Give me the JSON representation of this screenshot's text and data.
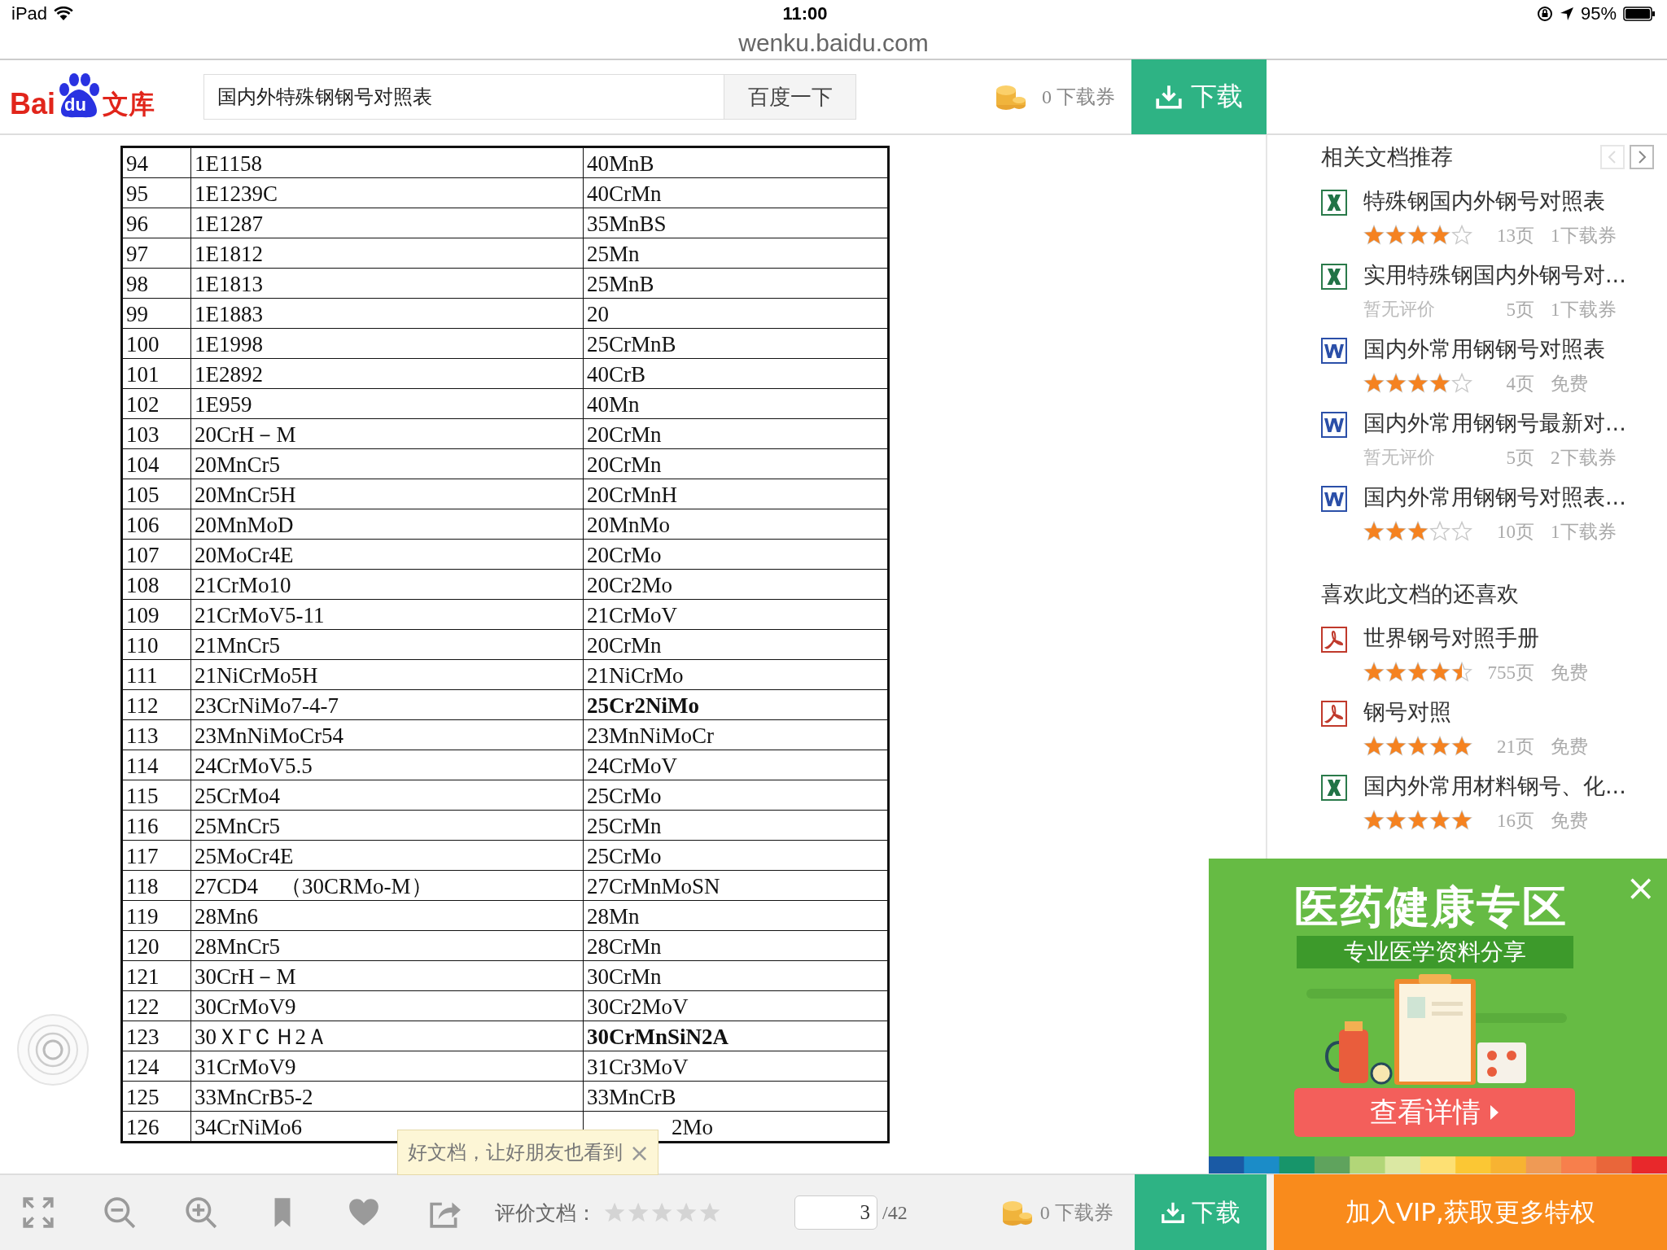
{
  "status_bar": {
    "device": "iPad",
    "time": "11:00",
    "battery": "95%"
  },
  "url": "wenku.baidu.com",
  "header": {
    "logo": [
      "Bai",
      "du",
      "文库"
    ],
    "search": {
      "value": "国内外特殊钢钢号对照表"
    },
    "search_button": "百度一下",
    "coupons": "0 下载券",
    "download_button": "下载"
  },
  "document": {
    "rows": [
      {
        "cells": [
          "94",
          "1E1158",
          "40MnB"
        ],
        "emphasized": false
      },
      {
        "cells": [
          "95",
          "1E1239C",
          "40CrMn"
        ],
        "emphasized": false
      },
      {
        "cells": [
          "96",
          "1E1287",
          "35MnBS"
        ],
        "emphasized": false
      },
      {
        "cells": [
          "97",
          "1E1812",
          "25Mn"
        ],
        "emphasized": false
      },
      {
        "cells": [
          "98",
          "1E1813",
          "25MnB"
        ],
        "emphasized": false
      },
      {
        "cells": [
          "99",
          "1E1883",
          "20"
        ],
        "emphasized": false
      },
      {
        "cells": [
          "100",
          "1E1998",
          "25CrMnB"
        ],
        "emphasized": false
      },
      {
        "cells": [
          "101",
          "1E2892",
          "40CrB"
        ],
        "emphasized": false
      },
      {
        "cells": [
          "102",
          "1E959",
          "40Mn"
        ],
        "emphasized": false
      },
      {
        "cells": [
          "103",
          "20CrH－M",
          "20CrMn"
        ],
        "emphasized": false
      },
      {
        "cells": [
          "104",
          "20MnCr5",
          "20CrMn"
        ],
        "emphasized": false
      },
      {
        "cells": [
          "105",
          "20MnCr5H",
          "20CrMnH"
        ],
        "emphasized": false
      },
      {
        "cells": [
          "106",
          "20MnMoD",
          "20MnMo"
        ],
        "emphasized": false
      },
      {
        "cells": [
          "107",
          "20MoCr4E",
          "20CrMo"
        ],
        "emphasized": false
      },
      {
        "cells": [
          "108",
          "21CrMo10",
          "20Cr2Mo"
        ],
        "emphasized": false
      },
      {
        "cells": [
          "109",
          "21CrMoV5-11",
          "21CrMoV"
        ],
        "emphasized": false
      },
      {
        "cells": [
          "110",
          "21MnCr5",
          "20CrMn"
        ],
        "emphasized": false
      },
      {
        "cells": [
          "111",
          "21NiCrMo5H",
          "21NiCrMo"
        ],
        "emphasized": false
      },
      {
        "cells": [
          "112",
          "23CrNiMo7-4-7",
          "25Cr2NiMo"
        ],
        "emphasized": true
      },
      {
        "cells": [
          "113",
          "23MnNiMoCr54",
          "23MnNiMoCr"
        ],
        "emphasized": false
      },
      {
        "cells": [
          "114",
          "24CrMoV5.5",
          "24CrMoV"
        ],
        "emphasized": false
      },
      {
        "cells": [
          "115",
          "25CrMo4",
          "25CrMo"
        ],
        "emphasized": false
      },
      {
        "cells": [
          "116",
          "25MnCr5",
          "25CrMn"
        ],
        "emphasized": false
      },
      {
        "cells": [
          "117",
          "25MoCr4E",
          "25CrMo"
        ],
        "emphasized": false
      },
      {
        "cells": [
          "118",
          "27CD4　（30CRMo-M）",
          "27CrMnMoSN"
        ],
        "emphasized": false
      },
      {
        "cells": [
          "119",
          "28Mn6",
          "28Mn"
        ],
        "emphasized": false
      },
      {
        "cells": [
          "120",
          "28MnCr5",
          "28CrMn"
        ],
        "emphasized": false
      },
      {
        "cells": [
          "121",
          "30CrH－M",
          "30CrMn"
        ],
        "emphasized": false
      },
      {
        "cells": [
          "122",
          "30CrMoV9",
          "30Cr2MoV"
        ],
        "emphasized": false
      },
      {
        "cells": [
          "123",
          "30ＸΓＣＨ2Ａ",
          "30CrMnSiN2A"
        ],
        "emphasized": true
      },
      {
        "cells": [
          "124",
          "31CrMoV9",
          "31Cr3MoV"
        ],
        "emphasized": false
      },
      {
        "cells": [
          "125",
          "33MnCrB5-2",
          "33MnCrB"
        ],
        "emphasized": false
      },
      {
        "cells": [
          "126",
          "34CrNiMo6",
          "2Mo"
        ],
        "emphasized": false,
        "column_3_covered": true
      }
    ]
  },
  "sidebar": {
    "sections": [
      {
        "title": "相关文档推荐",
        "pager": [
          {
            "kind": "prev",
            "disabled": true
          },
          {
            "kind": "next",
            "disabled": false
          }
        ],
        "items": [
          {
            "kind": "xls",
            "title": "特殊钢国内外钢号对照表",
            "stars": 4,
            "pages": "13页",
            "price": "1下载券"
          },
          {
            "kind": "xls",
            "title": "实用特殊钢国内外钢号对...",
            "rating_text": "暂无评价",
            "pages": "5页",
            "price": "1下载券"
          },
          {
            "kind": "doc",
            "title": "国内外常用钢钢号对照表",
            "stars": 4,
            "pages": "4页",
            "price": "免费"
          },
          {
            "kind": "doc",
            "title": "国内外常用钢钢号最新对...",
            "rating_text": "暂无评价",
            "pages": "5页",
            "price": "2下载券"
          },
          {
            "kind": "doc",
            "title": "国内外常用钢钢号对照表...",
            "stars": 3,
            "pages": "10页",
            "price": "1下载券"
          }
        ]
      },
      {
        "title": "喜欢此文档的还喜欢",
        "items": [
          {
            "kind": "pdf",
            "title": "世界钢号对照手册",
            "stars": 4.5,
            "pages": "755页",
            "price": "免费"
          },
          {
            "kind": "pdf",
            "title": "钢号对照",
            "stars": 5,
            "pages": "21页",
            "price": "免费"
          },
          {
            "kind": "xls",
            "title": "国内外常用材料钢号、化...",
            "stars": 5,
            "pages": "16页",
            "price": "免费"
          }
        ]
      }
    ]
  },
  "tooltip": {
    "text": "好文档，让好朋友也看到",
    "close": "×"
  },
  "ad": {
    "title": "医药健康专区",
    "subtitle": "专业医学资料分享",
    "button": "查看详情",
    "close": "×"
  },
  "toolbar": {
    "rate_label": "评价文档：",
    "stars": 0,
    "page": {
      "value": "3",
      "total": "/42"
    },
    "coupons": "0 下载券",
    "download_button": "下载",
    "vip_button": "加入VIP,获取更多特权"
  }
}
